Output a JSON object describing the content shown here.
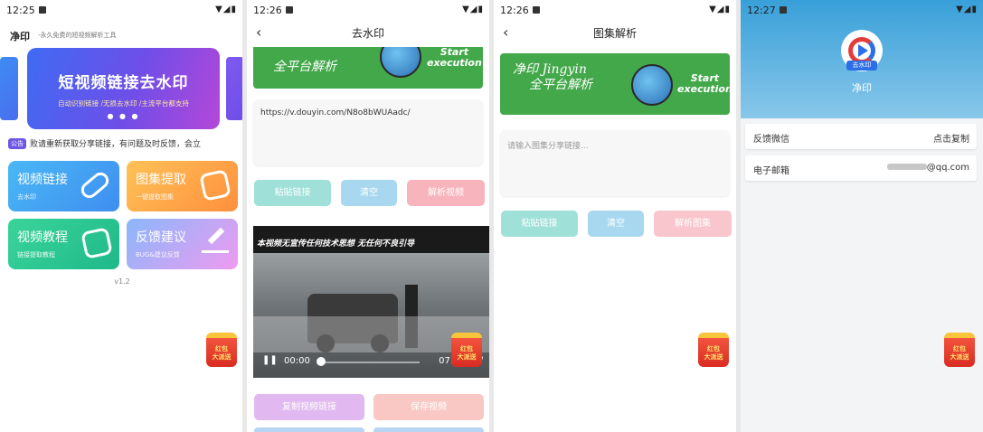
{
  "phone1": {
    "status_time": "12:25",
    "app_name": "净印",
    "app_tagline": "-永久免费的短视频解析工具",
    "banner": {
      "title": "短视频链接去水印",
      "subtitle": "自动识别链接 /无损去水印 /主流平台都支持",
      "dots": "● ● ●"
    },
    "notice_tag": "公告",
    "notice_text": "败请重新获取分享链接，有问题及时反馈，会立",
    "cards": [
      {
        "title": "视频链接",
        "sub": "去水印",
        "icon": "link-icon"
      },
      {
        "title": "图集提取",
        "sub": "一键提取图集",
        "icon": "image-icon"
      },
      {
        "title": "视频教程",
        "sub": "链接提取教程",
        "icon": "play-icon"
      },
      {
        "title": "反馈建议",
        "sub": "BUG&建议反馈",
        "icon": "edit-icon"
      }
    ],
    "version": "v1.2",
    "redpacket_line1": "红包",
    "redpacket_line2": "大派送"
  },
  "phone2": {
    "status_time": "12:26",
    "nav_title": "去水印",
    "banner_text": "全平台解析",
    "banner_start": "Start",
    "banner_execution": "execution",
    "url_value": "https://v.douyin.com/N8o8bWUAadc/",
    "buttons": {
      "paste": "粘贴链接",
      "clear": "清空",
      "parse": "解析视频"
    },
    "video": {
      "caption": "本视频无宣传任何技术思想  无任何不良引导",
      "current_time": "00:00",
      "duration": "07:54"
    },
    "bottom_buttons": {
      "copy": "复制视频链接",
      "save": "保存视频"
    },
    "redpacket_line1": "红包",
    "redpacket_line2": "大派送"
  },
  "phone3": {
    "status_time": "12:26",
    "nav_title": "图集解析",
    "banner_line1": "净印 Jingyin",
    "banner_line2": "全平台解析",
    "banner_start": "Start",
    "banner_execution": "execution",
    "input_placeholder": "请输入图集分享链接...",
    "buttons": {
      "paste": "粘贴链接",
      "clear": "清空",
      "parse": "解析图集"
    },
    "redpacket_line1": "红包",
    "redpacket_line2": "大派送"
  },
  "phone4": {
    "status_time": "12:27",
    "logo_badge": "去水印",
    "app_name": "净印",
    "rows": [
      {
        "label": "反馈微信",
        "value": "点击复制"
      },
      {
        "label": "电子邮箱",
        "value": "@qq.com"
      }
    ],
    "redpacket_line1": "红包",
    "redpacket_line2": "大派送"
  },
  "colors": {
    "accent_blue": "#3e6bf3",
    "accent_purple": "#6f56e6",
    "banner_green": "#42a84a",
    "btn_teal": "#9fe0d8",
    "btn_blue": "#a8d8ef",
    "btn_pink": "#f7b4bd",
    "profile_blue": "#38a0d9"
  }
}
